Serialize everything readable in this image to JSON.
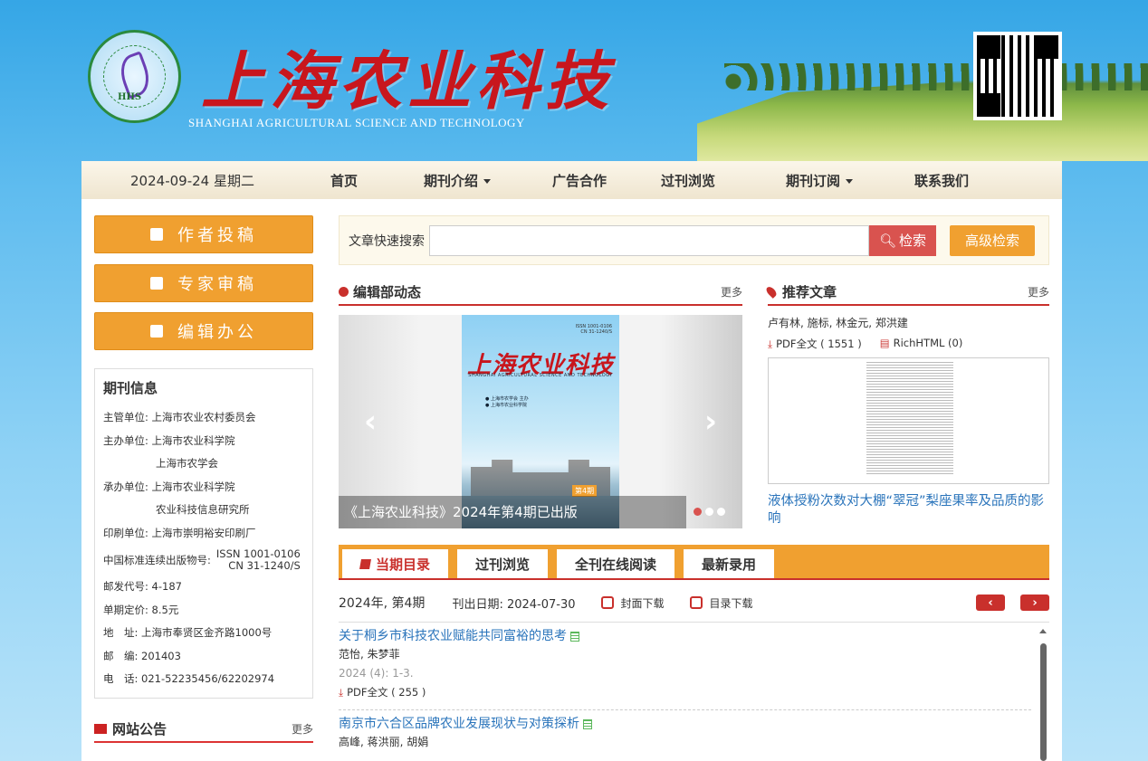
{
  "header": {
    "title_cn": "上海农业科技",
    "title_en": "SHANGHAI AGRICULTURAL SCIENCE AND TECHNOLOGY",
    "logo_mark": "HHS"
  },
  "nav": {
    "date": "2024-09-24 星期二",
    "items": [
      "首页",
      "期刊介绍",
      "广告合作",
      "过刊浏览",
      "期刊订阅",
      "联系我们"
    ]
  },
  "sidebar": {
    "buttons": [
      "作者投稿",
      "专家审稿",
      "编辑办公"
    ],
    "info_title": "期刊信息",
    "info": {
      "supervisor": "主管单位: 上海市农业农村委员会",
      "sponsor1": "主办单位: 上海市农业科学院",
      "sponsor2": "上海市农学会",
      "undertaker1": "承办单位: 上海市农业科学院",
      "undertaker2": "农业科技信息研究所",
      "printer": "印刷单位: 上海市崇明裕安印刷厂",
      "issn_label": "中国标准连续出版物号:",
      "issn": "ISSN 1001-0106",
      "cn": "CN  31-1240/S",
      "post_code": "邮发代号: 4-187",
      "price": "单期定价: 8.5元",
      "address": "地　址: 上海市奉贤区金齐路1000号",
      "zip": "邮　编: 201403",
      "phone": "电　话: 021-52235456/62202974"
    },
    "notice_title": "网站公告",
    "more": "更多"
  },
  "search": {
    "label": "文章快速搜索",
    "value": "",
    "button": "检索",
    "advanced": "高级检索"
  },
  "news": {
    "title": "编辑部动态",
    "more": "更多",
    "carousel_caption": "《上海农业科技》2024年第4期已出版",
    "cover": {
      "title": "上海农业科技",
      "subtitle": "SHANGHAI AGRICULTURAL SCIENCE AND TECHNOLOGY",
      "issn": "ISSN 1001-0106",
      "cn": "CN 31-1240/S",
      "org1": "上海市农学会",
      "org2": "上海市农业科学院",
      "org_suffix": "主办",
      "issue": "第4期"
    }
  },
  "recommend": {
    "title": "推荐文章",
    "more": "更多",
    "authors": "卢有林, 施标, 林金元, 郑洪建",
    "pdf": "PDF全文 ( 1551 )",
    "html": "RichHTML (0)",
    "article_title": "液体授粉次数对大棚“翠冠”梨座果率及品质的影响"
  },
  "tabs": [
    "当期目录",
    "过刊浏览",
    "全刊在线阅读",
    "最新录用"
  ],
  "issue": {
    "label": "2024年, 第4期",
    "pub_date": "刊出日期: 2024-07-30",
    "cover_download": "封面下载",
    "toc_download": "目录下载"
  },
  "articles": [
    {
      "title": "关于桐乡市科技农业赋能共同富裕的思考",
      "authors": "范怡, 朱梦菲",
      "citation": "2024 (4): 1-3.",
      "pdf": "PDF全文 ( 255 )"
    },
    {
      "title": "南京市六合区品牌农业发展现状与对策探析",
      "authors": "高峰, 蒋洪丽, 胡娟",
      "citation": "",
      "pdf": ""
    }
  ],
  "colors": {
    "accent": "#f0a030",
    "brand_red": "#c9302c",
    "link": "#2a74bb"
  }
}
